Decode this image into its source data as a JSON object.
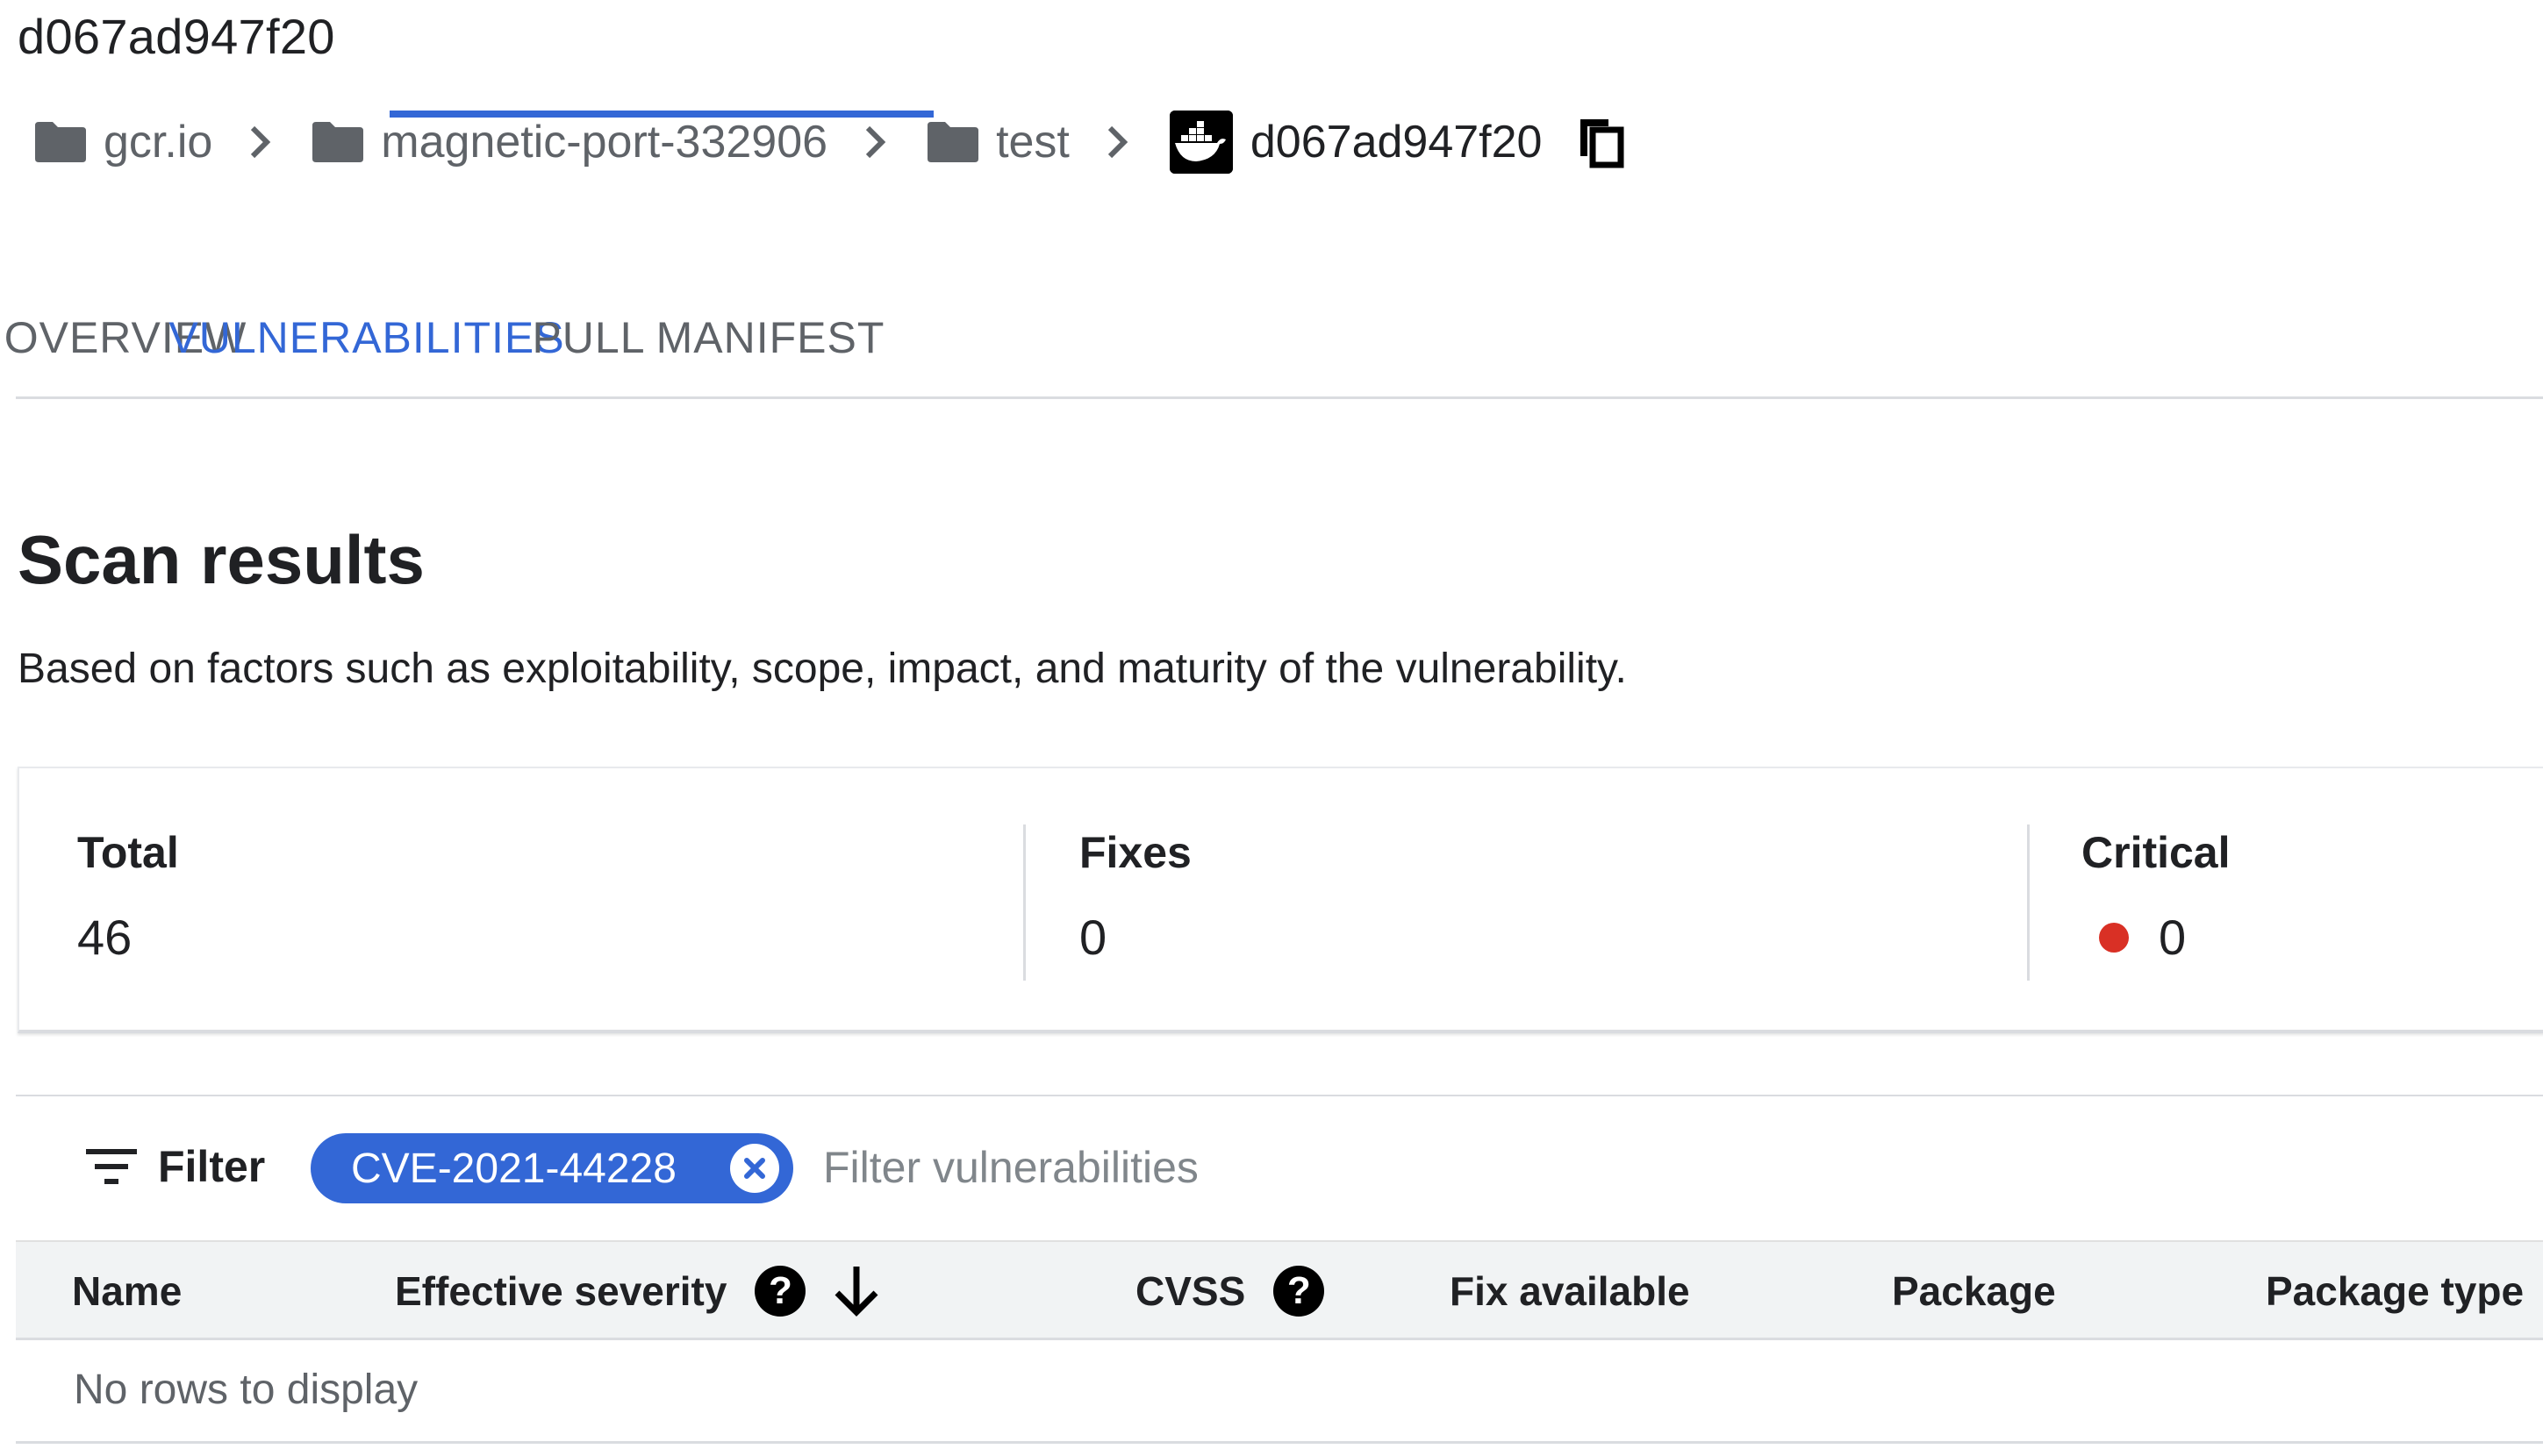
{
  "header": {
    "title": "d067ad947f20"
  },
  "breadcrumb": {
    "items": [
      {
        "label": "gcr.io",
        "icon": "folder-icon"
      },
      {
        "label": "magnetic-port-332906",
        "icon": "folder-icon"
      },
      {
        "label": "test",
        "icon": "folder-icon"
      },
      {
        "label": "d067ad947f20",
        "icon": "docker-icon"
      }
    ],
    "copy_icon": "copy-icon"
  },
  "tabs": [
    {
      "label": "OVERVIEW",
      "active": false
    },
    {
      "label": "VULNERABILITIES",
      "active": true
    },
    {
      "label": "PULL",
      "active": false
    },
    {
      "label": "MANIFEST",
      "active": false
    }
  ],
  "scan": {
    "title": "Scan results",
    "description": "Based on factors such as exploitability, scope, impact, and maturity of the vulnerability.",
    "stats": [
      {
        "label": "Total",
        "value": "46"
      },
      {
        "label": "Fixes",
        "value": "0"
      },
      {
        "label": "Critical",
        "value": "0",
        "color": "#d93025"
      }
    ]
  },
  "filter": {
    "label": "Filter",
    "chip_label": "CVE-2021-44228",
    "placeholder": "Filter vulnerabilities"
  },
  "table": {
    "columns": [
      {
        "label": "Name"
      },
      {
        "label": "Effective severity",
        "help": true,
        "sorted": "desc"
      },
      {
        "label": "CVSS",
        "help": true
      },
      {
        "label": "Fix available"
      },
      {
        "label": "Package"
      },
      {
        "label": "Package type"
      }
    ],
    "empty_text": "No rows to display"
  },
  "colors": {
    "accent": "#3367d6",
    "critical": "#d93025"
  }
}
